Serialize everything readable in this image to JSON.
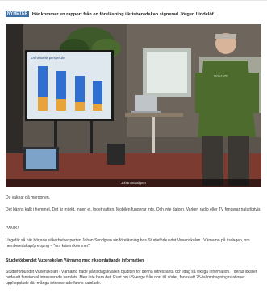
{
  "article": {
    "badge": "NYHETER",
    "headline": "Här kommer en rapport från en föreläsning i krisberedskap signerad Jörgen Lindelöf.",
    "photo": {
      "caption": "Johan Sundgren",
      "screen_title": "En historisk perspektiv",
      "shirt_text": "NOKIATE"
    },
    "paragraphs": {
      "p1": "Du vaknar på morgonen.",
      "p2": "Det känns kallt i hemmet. Det är mörkt, ingen el. Inget vatten. Mobilen fungerar inte. Och inte datorn. Varken radio eller TV fungerar naturligtvis.",
      "p3": "PANIK!",
      "p4": "Ungefär så här började säkerhetsexperten Johan Sundgren sin föreläsning hos Studieförbundet Vuxenskolan i Värnamo på tisdagen, om hemberedskap/prepping – \"om krisen kommer\".",
      "heading": "Studieförbundet Vuxenskolan Värnamo med riksomfattande information",
      "p5": "Studieförbundet Vuxenskolan i Värnamo hade på tisdagskvällen bjudit in för denna intressanta och idag så viktiga information. I deras lokaler hade ett fenstontal intresserade samlats. Men inte bara det. Runt om i Sverige från norr till söder, fanns ett 25-tal mottagningsstationer uppkopplade där många intresserade fanns samlade."
    }
  },
  "colors": {
    "badge": "#3f6fa8",
    "bar_blue": "#2f6fd1",
    "bar_orange": "#e8a33a",
    "shirt_green": "#4c6b2c"
  }
}
